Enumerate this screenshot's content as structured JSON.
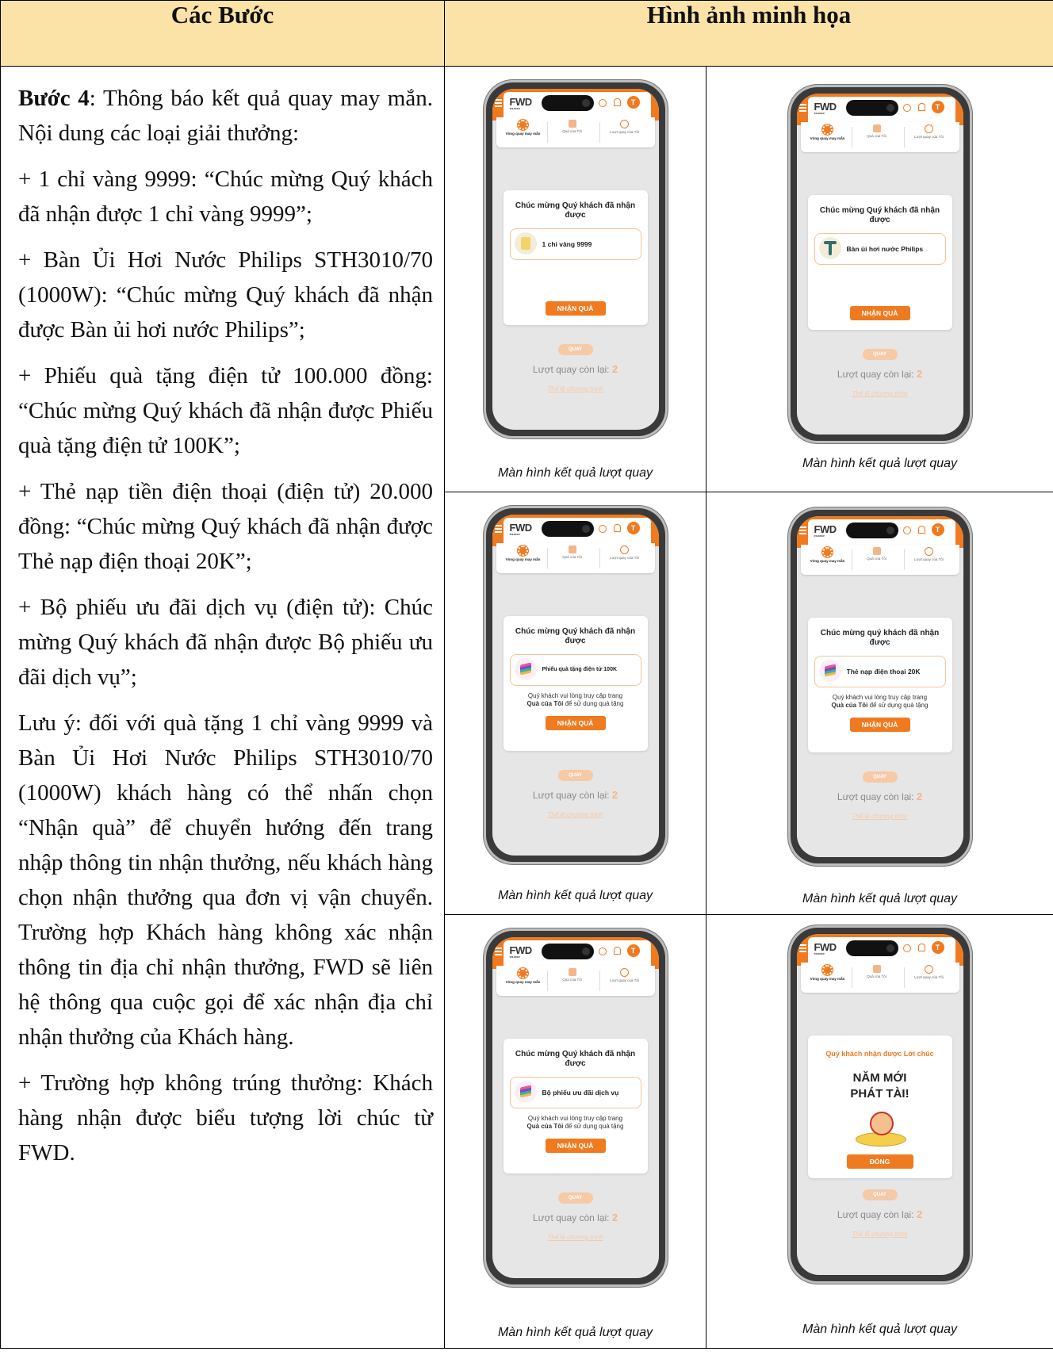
{
  "header": {
    "col1": "Các Bước",
    "col2": "Hình ảnh minh họa"
  },
  "steps": {
    "step_label": "Bước 4",
    "step_intro": ": Thông báo kết quả quay may mắn. Nội dung các loại giải thưởng:",
    "items": [
      "+ 1 chỉ vàng 9999: “Chúc mừng Quý khách đã nhận được 1 chỉ vàng 9999”;",
      "+ Bàn Ủi Hơi Nước Philips STH3010/70 (1000W): “Chúc mừng Quý khách đã nhận được Bàn ủi hơi nước Philips”;",
      "+ Phiếu quà tặng điện tử 100.000 đồng: “Chúc mừng Quý khách đã nhận được Phiếu quà tặng điện tử 100K”;",
      "+ Thẻ nạp tiền điện thoại (điện tử) 20.000 đồng: “Chúc mừng Quý khách đã nhận được Thẻ nạp điện thoại 20K”;",
      "+ Bộ phiếu ưu đãi dịch vụ (điện tử): Chúc mừng Quý khách đã nhận được Bộ phiếu ưu đãi dịch vụ”;",
      "Lưu ý: đối với quà tặng 1 chỉ vàng 9999 và Bàn Ủi Hơi Nước Philips STH3010/70 (1000W) khách hàng có thể nhấn chọn “Nhận quà” để chuyển hướng đến trang nhập thông tin nhận thưởng, nếu khách hàng chọn nhận thưởng qua đơn vị vận chuyển. Trường hợp Khách hàng không xác nhận thông tin địa chỉ nhận thưởng, FWD sẽ liên hệ thông qua cuộc gọi để xác nhận địa chỉ nhận thưởng của Khách hàng.",
      "+ Trường hợp không trúng thưởng: Khách hàng nhận được biểu tượng lời chúc từ FWD."
    ]
  },
  "phone_common": {
    "logo": "FWD",
    "logo_sub": "Insurance",
    "avatar_letter": "T",
    "tab1": "Vòng quay may mắn",
    "tab2": "Quà của Tôi",
    "tab3": "Lượt quay của Tôi",
    "spin_button": "QUAY",
    "remaining_label": "Lượt quay còn lại:",
    "remaining_value": "2",
    "rules_link": "Thể lệ chương trình",
    "caption": "Màn hình kết quả lượt quay",
    "claim_button": "NHẬN QUÀ",
    "note_pre": "Quý khách vui lòng truy cập trang",
    "note_bold": "Quà của Tôi",
    "note_post": "để sử dụng quà tặng"
  },
  "screens": {
    "s1": {
      "title": "Chúc mừng Quý khách đã nhận được",
      "prize": "1 chỉ vàng 9999"
    },
    "s2": {
      "title": "Chúc mừng Quý khách đã nhận được",
      "prize": "Bàn ủi hơi nước Philips"
    },
    "s3": {
      "title": "Chúc mừng Quý khách đã nhận được",
      "prize": "Phiếu quà tặng điện tử 100K"
    },
    "s4": {
      "title": "Chúc mừng quý khách đã nhận được",
      "prize": "Thẻ nạp điện thoại 20K"
    },
    "s5": {
      "title": "Chúc mừng Quý khách đã nhận được",
      "prize": "Bộ phiếu ưu đãi dịch vụ"
    },
    "s6": {
      "wish_label": "Quý khách nhận được Lời chúc",
      "wish_line1": "NĂM MỚI",
      "wish_line2": "PHÁT TÀI!",
      "close_button": "ĐÓNG"
    }
  }
}
